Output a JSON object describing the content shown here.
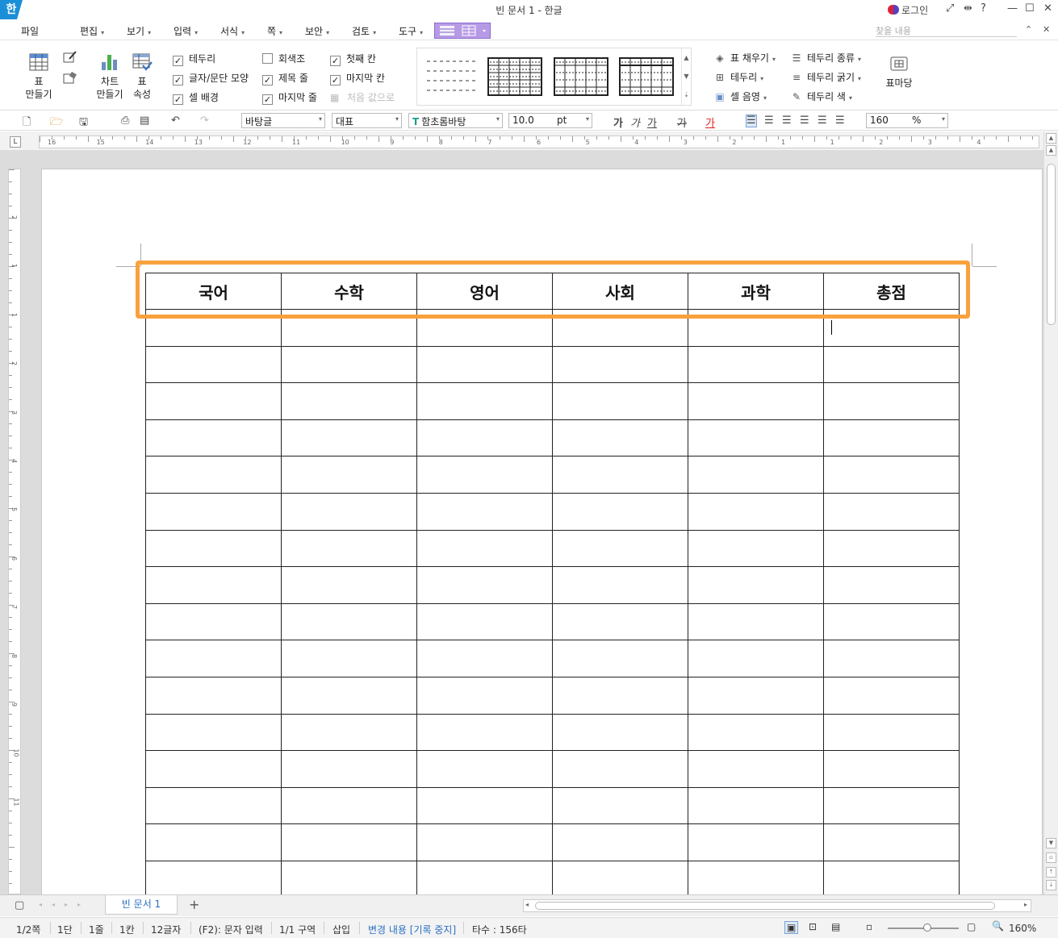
{
  "titlebar": {
    "app_logo": "한",
    "title": "빈 문서 1 - 한글",
    "login": "로그인",
    "help": "?",
    "minimize": "—",
    "maximize": "☐",
    "close": "✕"
  },
  "menu": {
    "file": "파일",
    "items": [
      "편집",
      "보기",
      "입력",
      "서식",
      "쪽",
      "보안",
      "검토",
      "도구"
    ],
    "search_placeholder": "찾을 내용"
  },
  "ribbon": {
    "table_create": {
      "line1": "표",
      "line2": "만들기"
    },
    "chart_create": {
      "line1": "차트",
      "line2": "만들기"
    },
    "table_props": {
      "line1": "표",
      "line2": "속성"
    },
    "checkboxes": [
      {
        "label": "테두리",
        "checked": true
      },
      {
        "label": "글자/문단 모양",
        "checked": true
      },
      {
        "label": "셀 배경",
        "checked": true
      },
      {
        "label": "회색조",
        "checked": false
      },
      {
        "label": "제목 줄",
        "checked": true
      },
      {
        "label": "마지막 줄",
        "checked": true
      },
      {
        "label": "첫째 칸",
        "checked": true
      },
      {
        "label": "마지막 칸",
        "checked": true
      }
    ],
    "reset_values": "처음 값으로",
    "fill": "표 채우기",
    "border": "테두리",
    "cell_shade": "셀 음영",
    "border_type": "테두리 종류",
    "border_width": "테두리 굵기",
    "border_color": "테두리 색",
    "table_madang": "표마당"
  },
  "formatbar": {
    "style": "바탕글",
    "lang": "대표",
    "font": "함초롬바탕",
    "size": "10.0",
    "unit": "pt",
    "zoom": "160",
    "zoom_unit": "%",
    "bold": "가",
    "italic": "가",
    "underline": "가",
    "strike": "가",
    "color": "가"
  },
  "ruler": {
    "corner": "L",
    "numbers": [
      "16",
      "15",
      "14",
      "13",
      "12",
      "11",
      "10",
      "9",
      "8",
      "7",
      "6",
      "5",
      "4",
      "3",
      "2",
      "1",
      "1",
      "2",
      "3",
      "4"
    ],
    "v_numbers": [
      "2",
      "1",
      "1",
      "2",
      "3",
      "4",
      "5",
      "6",
      "7",
      "8",
      "9",
      "10",
      "11"
    ]
  },
  "table": {
    "headers": [
      "국어",
      "수학",
      "영어",
      "사회",
      "과학",
      "총점"
    ],
    "empty_rows": 16
  },
  "tabs": {
    "doc_tab": "빈 문서 1",
    "add": "+"
  },
  "status": {
    "page": "1/2쪽",
    "column": "1단",
    "line": "1줄",
    "cell": "1칸",
    "chars": "12글자",
    "mode": "(F2): 문자 입력",
    "section": "1/1 구역",
    "insert": "삽입",
    "track": "변경 내용 [기록 중지]",
    "keystrokes": "타수 : 156타",
    "zoom": "160%"
  },
  "colors": {
    "highlight": "#f9a13c",
    "brand": "#1a8fd8",
    "active_tab": "#2a6fc4"
  }
}
